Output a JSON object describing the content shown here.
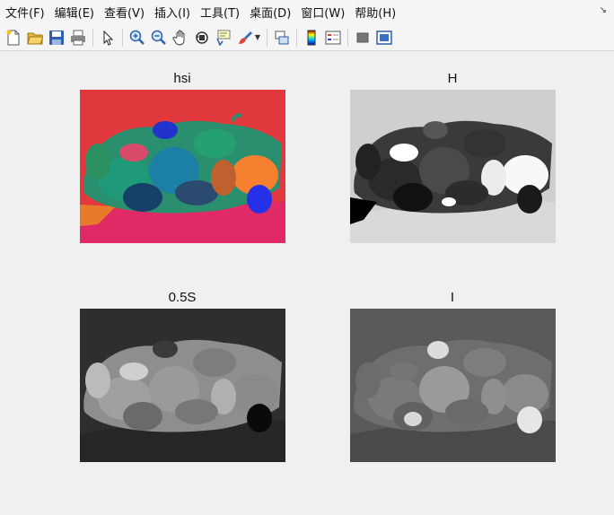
{
  "menubar": {
    "items": [
      "文件(F)",
      "编辑(E)",
      "查看(V)",
      "插入(I)",
      "工具(T)",
      "桌面(D)",
      "窗口(W)",
      "帮助(H)"
    ]
  },
  "toolbar": {
    "icons": [
      "new-figure-icon",
      "open-file-icon",
      "save-icon",
      "print-icon",
      "pointer-icon",
      "zoom-in-icon",
      "zoom-out-icon",
      "pan-icon",
      "rotate-3d-icon",
      "data-cursor-icon",
      "brush-icon",
      "link-plot-icon",
      "colorbar-icon",
      "legend-icon",
      "hide-plot-tools-icon",
      "show-plot-tools-icon"
    ]
  },
  "figure": {
    "panels": [
      {
        "title": "hsi"
      },
      {
        "title": "H"
      },
      {
        "title": "0.5S"
      },
      {
        "title": "I"
      }
    ]
  },
  "colors": {
    "menubar_bg": "#f5f5f5",
    "figure_bg": "#f0f0f0",
    "hsi_background": "#e0383c",
    "hsi_floor": "#e02a66"
  }
}
